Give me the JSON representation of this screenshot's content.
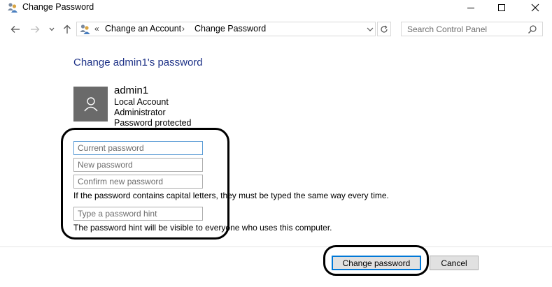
{
  "window": {
    "title": "Change Password",
    "icon": "users-icon",
    "controls": [
      "minimize-icon",
      "maximize-icon",
      "close-icon"
    ]
  },
  "nav": {
    "breadcrumb": [
      "Change an Account",
      "Change Password"
    ],
    "search_placeholder": "Search Control Panel"
  },
  "page": {
    "title": "Change admin1's password",
    "account": {
      "name": "admin1",
      "type": "Local Account",
      "role": "Administrator",
      "status": "Password protected"
    },
    "fields": {
      "current_placeholder": "Current password",
      "new_placeholder": "New password",
      "confirm_placeholder": "Confirm new password",
      "hint_placeholder": "Type a password hint"
    },
    "caps_note": "If the password contains capital letters, they must be typed the same way every time.",
    "hint_note": "The password hint will be visible to everyone who uses this computer."
  },
  "buttons": {
    "change": "Change password",
    "cancel": "Cancel"
  },
  "colors": {
    "title_blue": "#1e3287",
    "focus_blue": "#0078d7",
    "avatar_gray": "#6a6a6a"
  }
}
